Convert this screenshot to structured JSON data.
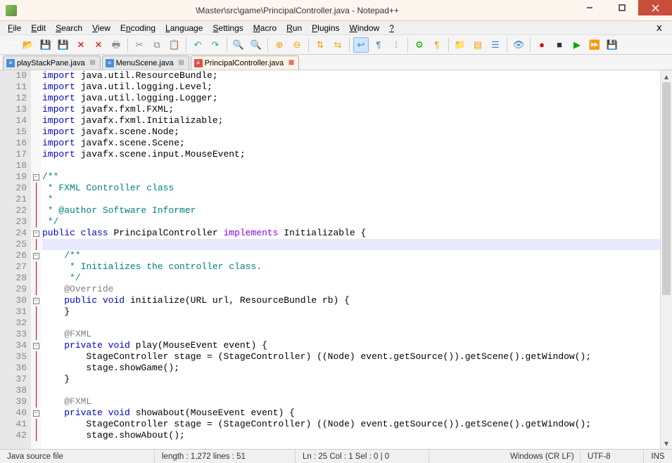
{
  "window": {
    "title": "\\Master\\src\\game\\PrincipalController.java - Notepad++"
  },
  "menus": [
    "File",
    "Edit",
    "Search",
    "View",
    "Encoding",
    "Language",
    "Settings",
    "Macro",
    "Run",
    "Plugins",
    "Window",
    "?"
  ],
  "menu_accel": [
    0,
    0,
    0,
    0,
    1,
    0,
    0,
    0,
    0,
    0,
    0,
    0
  ],
  "tabs": [
    {
      "label": "playStackPane.java",
      "active": false,
      "dirty": false
    },
    {
      "label": "MenuScene.java",
      "active": false,
      "dirty": false
    },
    {
      "label": "PrincipalController.java",
      "active": true,
      "dirty": true
    }
  ],
  "lines": [
    {
      "n": 10,
      "fold": " ",
      "seg": [
        [
          "kw",
          "import"
        ],
        [
          "pl",
          " java.util.ResourceBundle;"
        ]
      ]
    },
    {
      "n": 11,
      "fold": " ",
      "seg": [
        [
          "kw",
          "import"
        ],
        [
          "pl",
          " java.util.logging.Level;"
        ]
      ]
    },
    {
      "n": 12,
      "fold": " ",
      "seg": [
        [
          "kw",
          "import"
        ],
        [
          "pl",
          " java.util.logging.Logger;"
        ]
      ]
    },
    {
      "n": 13,
      "fold": " ",
      "seg": [
        [
          "kw",
          "import"
        ],
        [
          "pl",
          " javafx.fxml.FXML;"
        ]
      ]
    },
    {
      "n": 14,
      "fold": " ",
      "seg": [
        [
          "kw",
          "import"
        ],
        [
          "pl",
          " javafx.fxml.Initializable;"
        ]
      ]
    },
    {
      "n": 15,
      "fold": " ",
      "seg": [
        [
          "kw",
          "import"
        ],
        [
          "pl",
          " javafx.scene.Node;"
        ]
      ]
    },
    {
      "n": 16,
      "fold": " ",
      "seg": [
        [
          "kw",
          "import"
        ],
        [
          "pl",
          " javafx.scene.Scene;"
        ]
      ]
    },
    {
      "n": 17,
      "fold": " ",
      "seg": [
        [
          "kw",
          "import"
        ],
        [
          "pl",
          " javafx.scene.input.MouseEvent;"
        ]
      ]
    },
    {
      "n": 18,
      "fold": " ",
      "seg": [
        [
          "pl",
          ""
        ]
      ]
    },
    {
      "n": 19,
      "fold": "-",
      "seg": [
        [
          "cmt",
          "/**"
        ]
      ]
    },
    {
      "n": 20,
      "fold": "|",
      "seg": [
        [
          "cmt",
          " * FXML Controller class"
        ]
      ]
    },
    {
      "n": 21,
      "fold": "|",
      "seg": [
        [
          "cmt",
          " *"
        ]
      ]
    },
    {
      "n": 22,
      "fold": "|",
      "seg": [
        [
          "cmt",
          " * @author Software Informer"
        ]
      ]
    },
    {
      "n": 23,
      "fold": "|",
      "seg": [
        [
          "cmt",
          " */"
        ]
      ]
    },
    {
      "n": 24,
      "fold": "-",
      "seg": [
        [
          "kw",
          "public"
        ],
        [
          "pl",
          " "
        ],
        [
          "kw",
          "class"
        ],
        [
          "pl",
          " PrincipalController "
        ],
        [
          "kw2",
          "implements"
        ],
        [
          "pl",
          " Initializable {"
        ]
      ]
    },
    {
      "n": 25,
      "fold": "|",
      "current": true,
      "seg": [
        [
          "pl",
          ""
        ]
      ]
    },
    {
      "n": 26,
      "fold": "-",
      "seg": [
        [
          "pl",
          "    "
        ],
        [
          "cmt",
          "/**"
        ]
      ]
    },
    {
      "n": 27,
      "fold": "|",
      "seg": [
        [
          "pl",
          "    "
        ],
        [
          "cmt",
          " * Initializes the controller class."
        ]
      ]
    },
    {
      "n": 28,
      "fold": "|",
      "seg": [
        [
          "pl",
          "    "
        ],
        [
          "cmt",
          " */"
        ]
      ]
    },
    {
      "n": 29,
      "fold": "|",
      "seg": [
        [
          "pl",
          "    "
        ],
        [
          "anno",
          "@Override"
        ]
      ]
    },
    {
      "n": 30,
      "fold": "-",
      "seg": [
        [
          "pl",
          "    "
        ],
        [
          "kw",
          "public"
        ],
        [
          "pl",
          " "
        ],
        [
          "kw",
          "void"
        ],
        [
          "pl",
          " initialize(URL url, ResourceBundle rb) {"
        ]
      ]
    },
    {
      "n": 31,
      "fold": "|",
      "seg": [
        [
          "pl",
          "    }"
        ]
      ]
    },
    {
      "n": 32,
      "fold": "|",
      "seg": [
        [
          "pl",
          ""
        ]
      ]
    },
    {
      "n": 33,
      "fold": "|",
      "seg": [
        [
          "pl",
          "    "
        ],
        [
          "anno",
          "@FXML"
        ]
      ]
    },
    {
      "n": 34,
      "fold": "-",
      "seg": [
        [
          "pl",
          "    "
        ],
        [
          "kw",
          "private"
        ],
        [
          "pl",
          " "
        ],
        [
          "kw",
          "void"
        ],
        [
          "pl",
          " play(MouseEvent event) {"
        ]
      ]
    },
    {
      "n": 35,
      "fold": "|",
      "seg": [
        [
          "pl",
          "        StageController stage = (StageController) ((Node) event.getSource()).getScene().getWindow();"
        ]
      ]
    },
    {
      "n": 36,
      "fold": "|",
      "seg": [
        [
          "pl",
          "        stage.showGame();"
        ]
      ]
    },
    {
      "n": 37,
      "fold": "|",
      "seg": [
        [
          "pl",
          "    }"
        ]
      ]
    },
    {
      "n": 38,
      "fold": "|",
      "seg": [
        [
          "pl",
          ""
        ]
      ]
    },
    {
      "n": 39,
      "fold": "|",
      "seg": [
        [
          "pl",
          "    "
        ],
        [
          "anno",
          "@FXML"
        ]
      ]
    },
    {
      "n": 40,
      "fold": "-",
      "seg": [
        [
          "pl",
          "    "
        ],
        [
          "kw",
          "private"
        ],
        [
          "pl",
          " "
        ],
        [
          "kw",
          "void"
        ],
        [
          "pl",
          " showabout(MouseEvent event) {"
        ]
      ]
    },
    {
      "n": 41,
      "fold": "|",
      "seg": [
        [
          "pl",
          "        StageController stage = (StageController) ((Node) event.getSource()).getScene().getWindow();"
        ]
      ]
    },
    {
      "n": 42,
      "fold": "|",
      "seg": [
        [
          "pl",
          "        stage.showAbout();"
        ]
      ]
    }
  ],
  "status": {
    "filetype": "Java source file",
    "length": "length : 1,272    lines : 51",
    "pos": "Ln : 25   Col : 1   Sel : 0 | 0",
    "eol": "Windows (CR LF)",
    "enc": "UTF-8",
    "mode": "INS"
  },
  "toolbar_icons": [
    "new-icon",
    "open-icon",
    "save-icon",
    "save-all-icon",
    "close-icon",
    "close-all-icon",
    "print-icon",
    "sep",
    "cut-icon",
    "copy-icon",
    "paste-icon",
    "sep",
    "undo-icon",
    "redo-icon",
    "sep",
    "find-icon",
    "replace-icon",
    "sep",
    "zoom-in-icon",
    "zoom-out-icon",
    "sep",
    "sync-v-icon",
    "sync-h-icon",
    "sep",
    "wrap-icon",
    "show-all-icon",
    "indent-guide-icon",
    "sep",
    "lang-icon",
    "eol-icon",
    "sep",
    "folder-icon",
    "doc-map-icon",
    "func-list-icon",
    "sep",
    "monitor-icon",
    "sep",
    "record-icon",
    "stop-icon",
    "play-icon",
    "play-multi-icon",
    "save-macro-icon"
  ]
}
